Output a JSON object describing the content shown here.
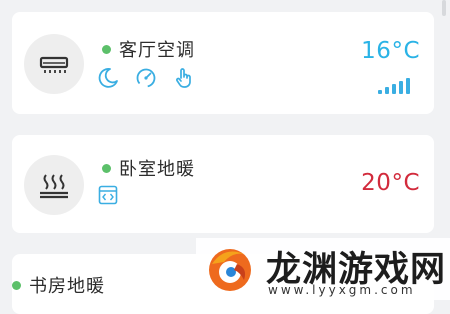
{
  "colors": {
    "online_dot": "#5cc06a",
    "cool_temp": "#2ab3e6",
    "heat_temp": "#d22b3c",
    "accent_icon": "#3aaee2"
  },
  "devices": [
    {
      "name": "客厅空调",
      "temperature": "16°C",
      "status": "online",
      "icon": "air-conditioner-icon",
      "controls": [
        "moon-icon",
        "speed-gauge-icon",
        "hand-touch-icon"
      ],
      "signal_level": 4
    },
    {
      "name": "卧室地暖",
      "temperature": "20°C",
      "status": "online",
      "icon": "floor-heating-icon",
      "controls": [
        "schedule-icon"
      ]
    },
    {
      "name": "书房地暖",
      "status": "online"
    }
  ],
  "watermark": {
    "name": "龙渊游戏网",
    "url": "www.lyyxgm.com"
  }
}
